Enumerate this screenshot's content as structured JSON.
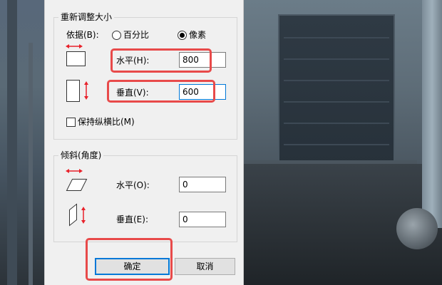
{
  "resize": {
    "group_title": "重新调整大小",
    "by_label": "依据(B):",
    "option_percent": "百分比",
    "option_pixels": "像素",
    "selected": "像素",
    "horizontal_label": "水平(H):",
    "horizontal_value": "800",
    "vertical_label": "垂直(V):",
    "vertical_value": "600",
    "keep_ratio_label": "保持纵横比(M)",
    "keep_ratio_checked": false
  },
  "skew": {
    "group_title": "倾斜(角度)",
    "horizontal_label": "水平(O):",
    "horizontal_value": "0",
    "vertical_label": "垂直(E):",
    "vertical_value": "0"
  },
  "buttons": {
    "ok": "确定",
    "cancel": "取消"
  },
  "colors": {
    "highlight": "#e84a4a",
    "arrow": "#e8212a",
    "focus": "#0078d7"
  }
}
